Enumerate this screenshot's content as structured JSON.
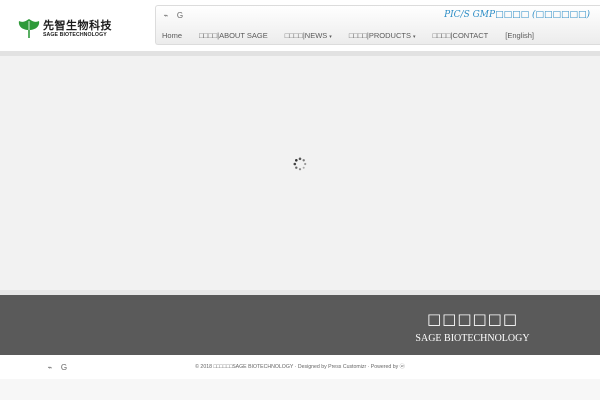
{
  "logo": {
    "chinese": "先智生物科技",
    "english": "SAGE BIOTECHNOLOGY"
  },
  "header": {
    "social": [
      {
        "icon": "rss-icon",
        "glyph": "⌁"
      },
      {
        "icon": "google-icon",
        "glyph": "G"
      }
    ],
    "tagline": "PIC/S GMP□□□□ (□□□□□□)"
  },
  "nav": {
    "items": [
      {
        "label": "Home",
        "caret": ""
      },
      {
        "label": "□□□□|ABOUT SAGE",
        "caret": ""
      },
      {
        "label": "□□□□|NEWS",
        "caret": "▾"
      },
      {
        "label": "□□□□|PRODUCTS",
        "caret": "▾"
      },
      {
        "label": "□□□□|CONTACT",
        "caret": ""
      },
      {
        "label": "[English]",
        "caret": ""
      }
    ]
  },
  "footer": {
    "title": "□□□□□□",
    "subtitle": "SAGE BIOTECHNOLOGY",
    "credits": "© 2018 □□□□□□SAGE BIOTECHNOLOGY · Designed by Press Customizr · Powered by ⓦ"
  },
  "colors": {
    "accent": "#2e8ec6",
    "footer_band": "#5a5a5a",
    "page_bg": "#f2f2f2"
  }
}
